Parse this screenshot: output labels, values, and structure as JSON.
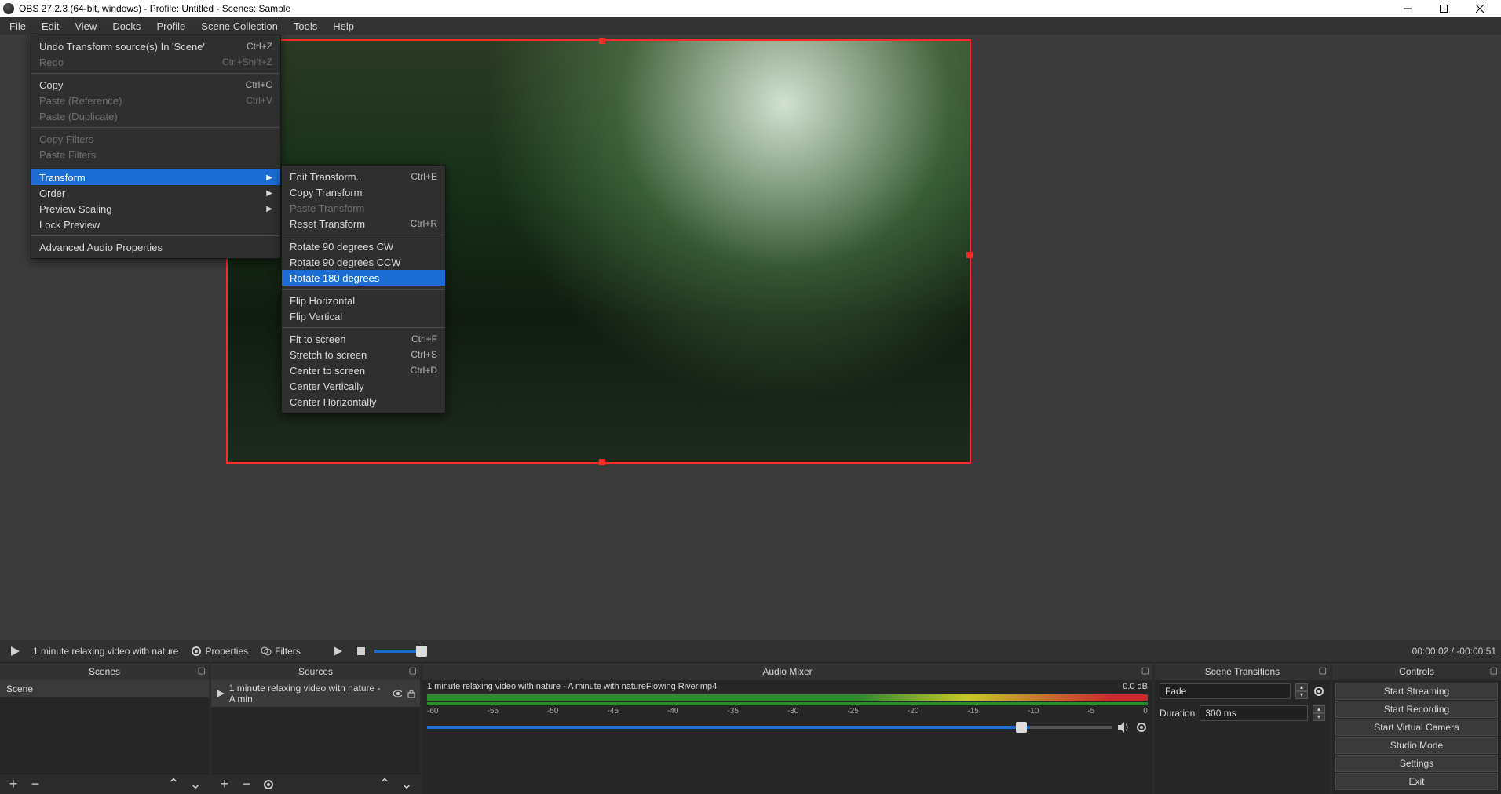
{
  "titlebar": {
    "title": "OBS 27.2.3 (64-bit, windows) - Profile: Untitled - Scenes: Sample"
  },
  "menubar": [
    "File",
    "Edit",
    "View",
    "Docks",
    "Profile",
    "Scene Collection",
    "Tools",
    "Help"
  ],
  "edit_menu": [
    {
      "label": "Undo Transform source(s) In 'Scene'",
      "accel": "Ctrl+Z",
      "disabled": false
    },
    {
      "label": "Redo",
      "accel": "Ctrl+Shift+Z",
      "disabled": true
    },
    "sep",
    {
      "label": "Copy",
      "accel": "Ctrl+C",
      "disabled": false
    },
    {
      "label": "Paste (Reference)",
      "accel": "Ctrl+V",
      "disabled": true
    },
    {
      "label": "Paste (Duplicate)",
      "accel": "",
      "disabled": true
    },
    "sep",
    {
      "label": "Copy Filters",
      "accel": "",
      "disabled": true
    },
    {
      "label": "Paste Filters",
      "accel": "",
      "disabled": true
    },
    "sep",
    {
      "label": "Transform",
      "submenu": true,
      "selected": true
    },
    {
      "label": "Order",
      "submenu": true
    },
    {
      "label": "Preview Scaling",
      "submenu": true
    },
    {
      "label": "Lock Preview",
      "accel": ""
    },
    "sep",
    {
      "label": "Advanced Audio Properties"
    }
  ],
  "transform_menu": [
    {
      "label": "Edit Transform...",
      "accel": "Ctrl+E"
    },
    {
      "label": "Copy Transform",
      "accel": ""
    },
    {
      "label": "Paste Transform",
      "accel": "",
      "disabled": true
    },
    {
      "label": "Reset Transform",
      "accel": "Ctrl+R"
    },
    "sep",
    {
      "label": "Rotate 90 degrees CW",
      "accel": ""
    },
    {
      "label": "Rotate 90 degrees CCW",
      "accel": ""
    },
    {
      "label": "Rotate 180 degrees",
      "accel": "",
      "selected": true
    },
    "sep",
    {
      "label": "Flip Horizontal",
      "accel": ""
    },
    {
      "label": "Flip Vertical",
      "accel": ""
    },
    "sep",
    {
      "label": "Fit to screen",
      "accel": "Ctrl+F"
    },
    {
      "label": "Stretch to screen",
      "accel": "Ctrl+S"
    },
    {
      "label": "Center to screen",
      "accel": "Ctrl+D"
    },
    {
      "label": "Center Vertically",
      "accel": ""
    },
    {
      "label": "Center Horizontally",
      "accel": ""
    }
  ],
  "preview_toolbar": {
    "source_name": "1 minute relaxing video with nature",
    "properties": "Properties",
    "filters": "Filters",
    "time": "00:00:02 / -00:00:51"
  },
  "docks": {
    "scenes": {
      "title": "Scenes",
      "items": [
        "Scene"
      ]
    },
    "sources": {
      "title": "Sources",
      "items": [
        "1 minute relaxing video with nature - A min"
      ]
    },
    "mixer": {
      "title": "Audio Mixer",
      "track_name": "1 minute relaxing video with nature - A minute with natureFlowing River.mp4",
      "db": "0.0 dB",
      "scale": [
        "-60",
        "-55",
        "-50",
        "-45",
        "-40",
        "-35",
        "-30",
        "-25",
        "-20",
        "-15",
        "-10",
        "-5",
        "0"
      ]
    },
    "transitions": {
      "title": "Scene Transitions",
      "type": "Fade",
      "duration_label": "Duration",
      "duration_value": "300 ms"
    },
    "controls": {
      "title": "Controls",
      "buttons": [
        "Start Streaming",
        "Start Recording",
        "Start Virtual Camera",
        "Studio Mode",
        "Settings",
        "Exit"
      ]
    }
  }
}
